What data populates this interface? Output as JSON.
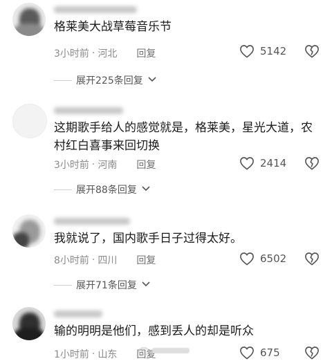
{
  "comments": [
    {
      "text": "格莱美大战草莓音乐节",
      "time": "3小时前",
      "location": "河北",
      "reply_label": "回复",
      "likes": "5142",
      "expand_label": "展开225条回复"
    },
    {
      "text": "这期歌手给人的感觉就是，格莱美，星光大道，农村红白喜事来回切换",
      "time": "3小时前",
      "location": "河南",
      "reply_label": "回复",
      "likes": "2414",
      "expand_label": "展开88条回复"
    },
    {
      "text": "我就说了，国内歌手日子过得太好。",
      "time": "8小时前",
      "location": "四川",
      "reply_label": "回复",
      "likes": "6502",
      "expand_label": "展开71条回复"
    },
    {
      "text": "输的明明是他们，感到丢人的却是听众",
      "time": "1小时前",
      "location": "山东",
      "reply_label": "回复",
      "likes": "675"
    }
  ],
  "icons": {
    "like": "heart-outline-icon",
    "dislike": "broken-heart-icon",
    "expand": "chevron-down-icon"
  },
  "colors": {
    "text": "#1a1a1a",
    "meta": "#8a8a8a"
  }
}
